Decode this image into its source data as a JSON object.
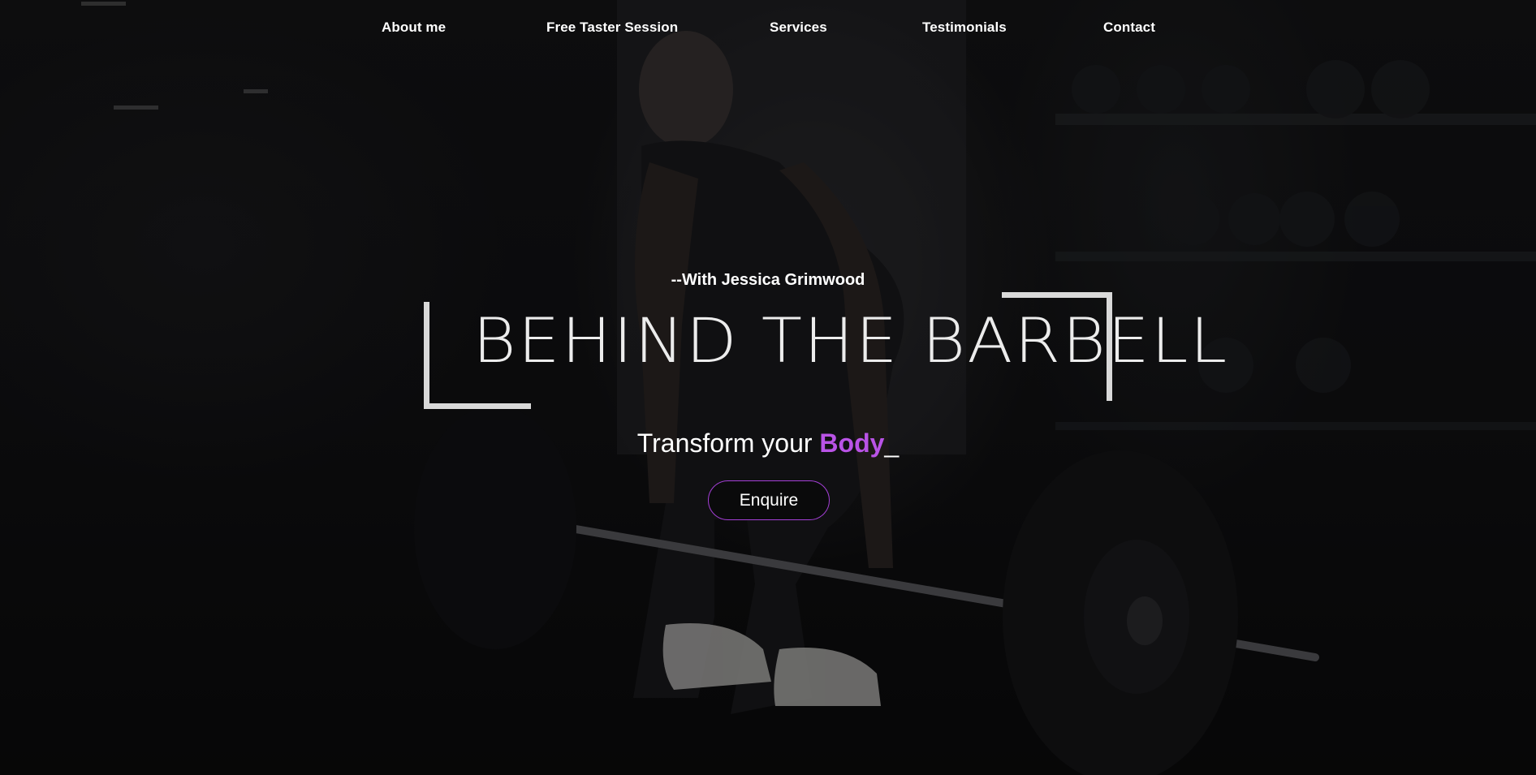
{
  "nav": {
    "items": [
      {
        "label": "About me"
      },
      {
        "label": "Free Taster Session"
      },
      {
        "label": "Services"
      },
      {
        "label": "Testimonials"
      },
      {
        "label": "Contact"
      }
    ]
  },
  "hero": {
    "tagline": "--With Jessica Grimwood",
    "logo_text": "BEHIND THE BARBELL",
    "headline_prefix": "Transform your ",
    "headline_accent": "Body",
    "headline_cursor": "_",
    "cta_label": "Enquire"
  },
  "colors": {
    "accent": "#b953e6",
    "button_border": "#a43fd6",
    "text": "#ffffff",
    "background": "#111113"
  }
}
